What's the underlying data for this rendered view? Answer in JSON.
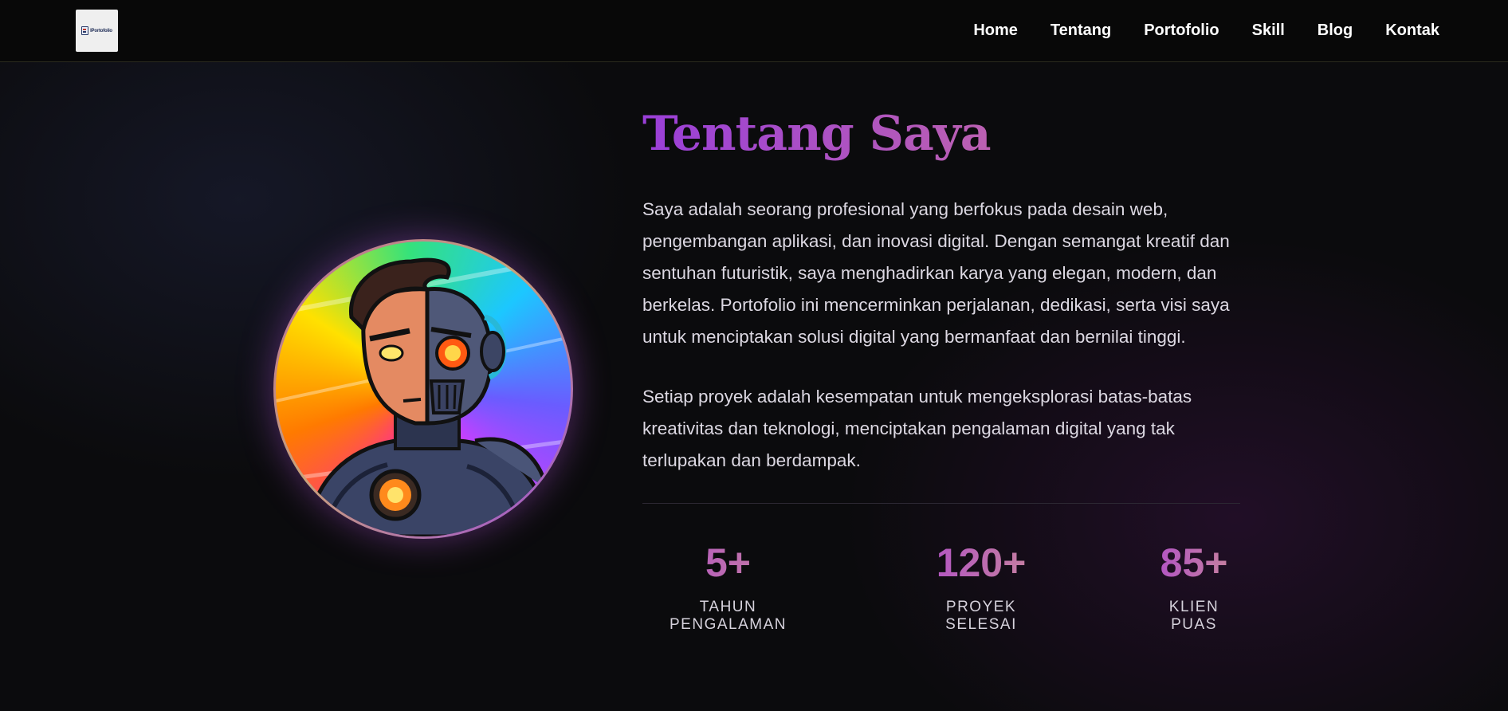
{
  "nav": {
    "logo_text": "IPortofolio",
    "items": [
      {
        "label": "Home"
      },
      {
        "label": "Tentang"
      },
      {
        "label": "Portofolio"
      },
      {
        "label": "Skill"
      },
      {
        "label": "Blog"
      },
      {
        "label": "Kontak"
      }
    ]
  },
  "about": {
    "title": "Tentang Saya",
    "paragraphs": [
      "Saya adalah seorang profesional yang berfokus pada desain web, pengembangan aplikasi, dan inovasi digital. Dengan semangat kreatif dan sentuhan futuristik, saya menghadirkan karya yang elegan, modern, dan berkelas. Portofolio ini mencerminkan perjalanan, dedikasi, serta visi saya untuk menciptakan solusi digital yang bermanfaat dan bernilai tinggi.",
      "Setiap proyek adalah kesempatan untuk mengeksplorasi batas-batas kreativitas dan teknologi, menciptakan pengalaman digital yang tak terlupakan dan berdampak."
    ],
    "stats": [
      {
        "value": "5+",
        "label": "TAHUN PENGALAMAN"
      },
      {
        "value": "120+",
        "label": "PROYEK SELESAI"
      },
      {
        "value": "85+",
        "label": "KLIEN PUAS"
      }
    ]
  },
  "colors": {
    "background": "#0b0b0d",
    "accent_purple": "#9a3fd8",
    "accent_pink": "#c8869a"
  }
}
